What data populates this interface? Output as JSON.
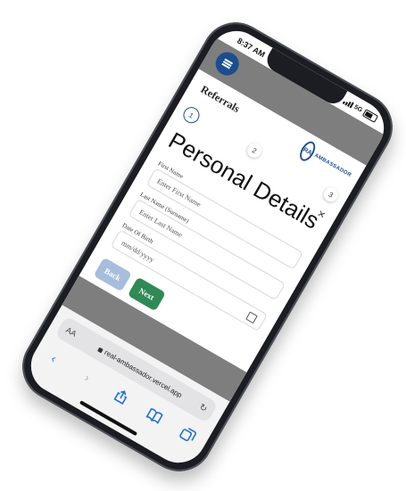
{
  "status": {
    "time": "8:37 AM",
    "network": "5G"
  },
  "app": {
    "title": "Referrals",
    "logo_text": "AMBASSADOR",
    "logo_initials": "RA"
  },
  "form": {
    "heading": "Personal Details",
    "steps": [
      "1",
      "2",
      "3"
    ],
    "active_step": 1,
    "close": "×",
    "first_name": {
      "label": "First Name",
      "placeholder": "Enter First Name"
    },
    "last_name": {
      "label": "Last Name (Surname)",
      "placeholder": "Enter Last Name"
    },
    "dob": {
      "label": "Date Of Birth",
      "placeholder": "mm/dd/yyyy"
    },
    "back_label": "Back",
    "next_label": "Next"
  },
  "browser": {
    "text_size": "AA",
    "url": "real-ambassador.vercel.app",
    "reload": "↻",
    "nav": {
      "back": "‹",
      "forward": "›"
    }
  },
  "colors": {
    "brand": "#1c4e8f",
    "next": "#2f8a55",
    "back": "#a7bddd",
    "safari_blue": "#1f6fd8"
  }
}
